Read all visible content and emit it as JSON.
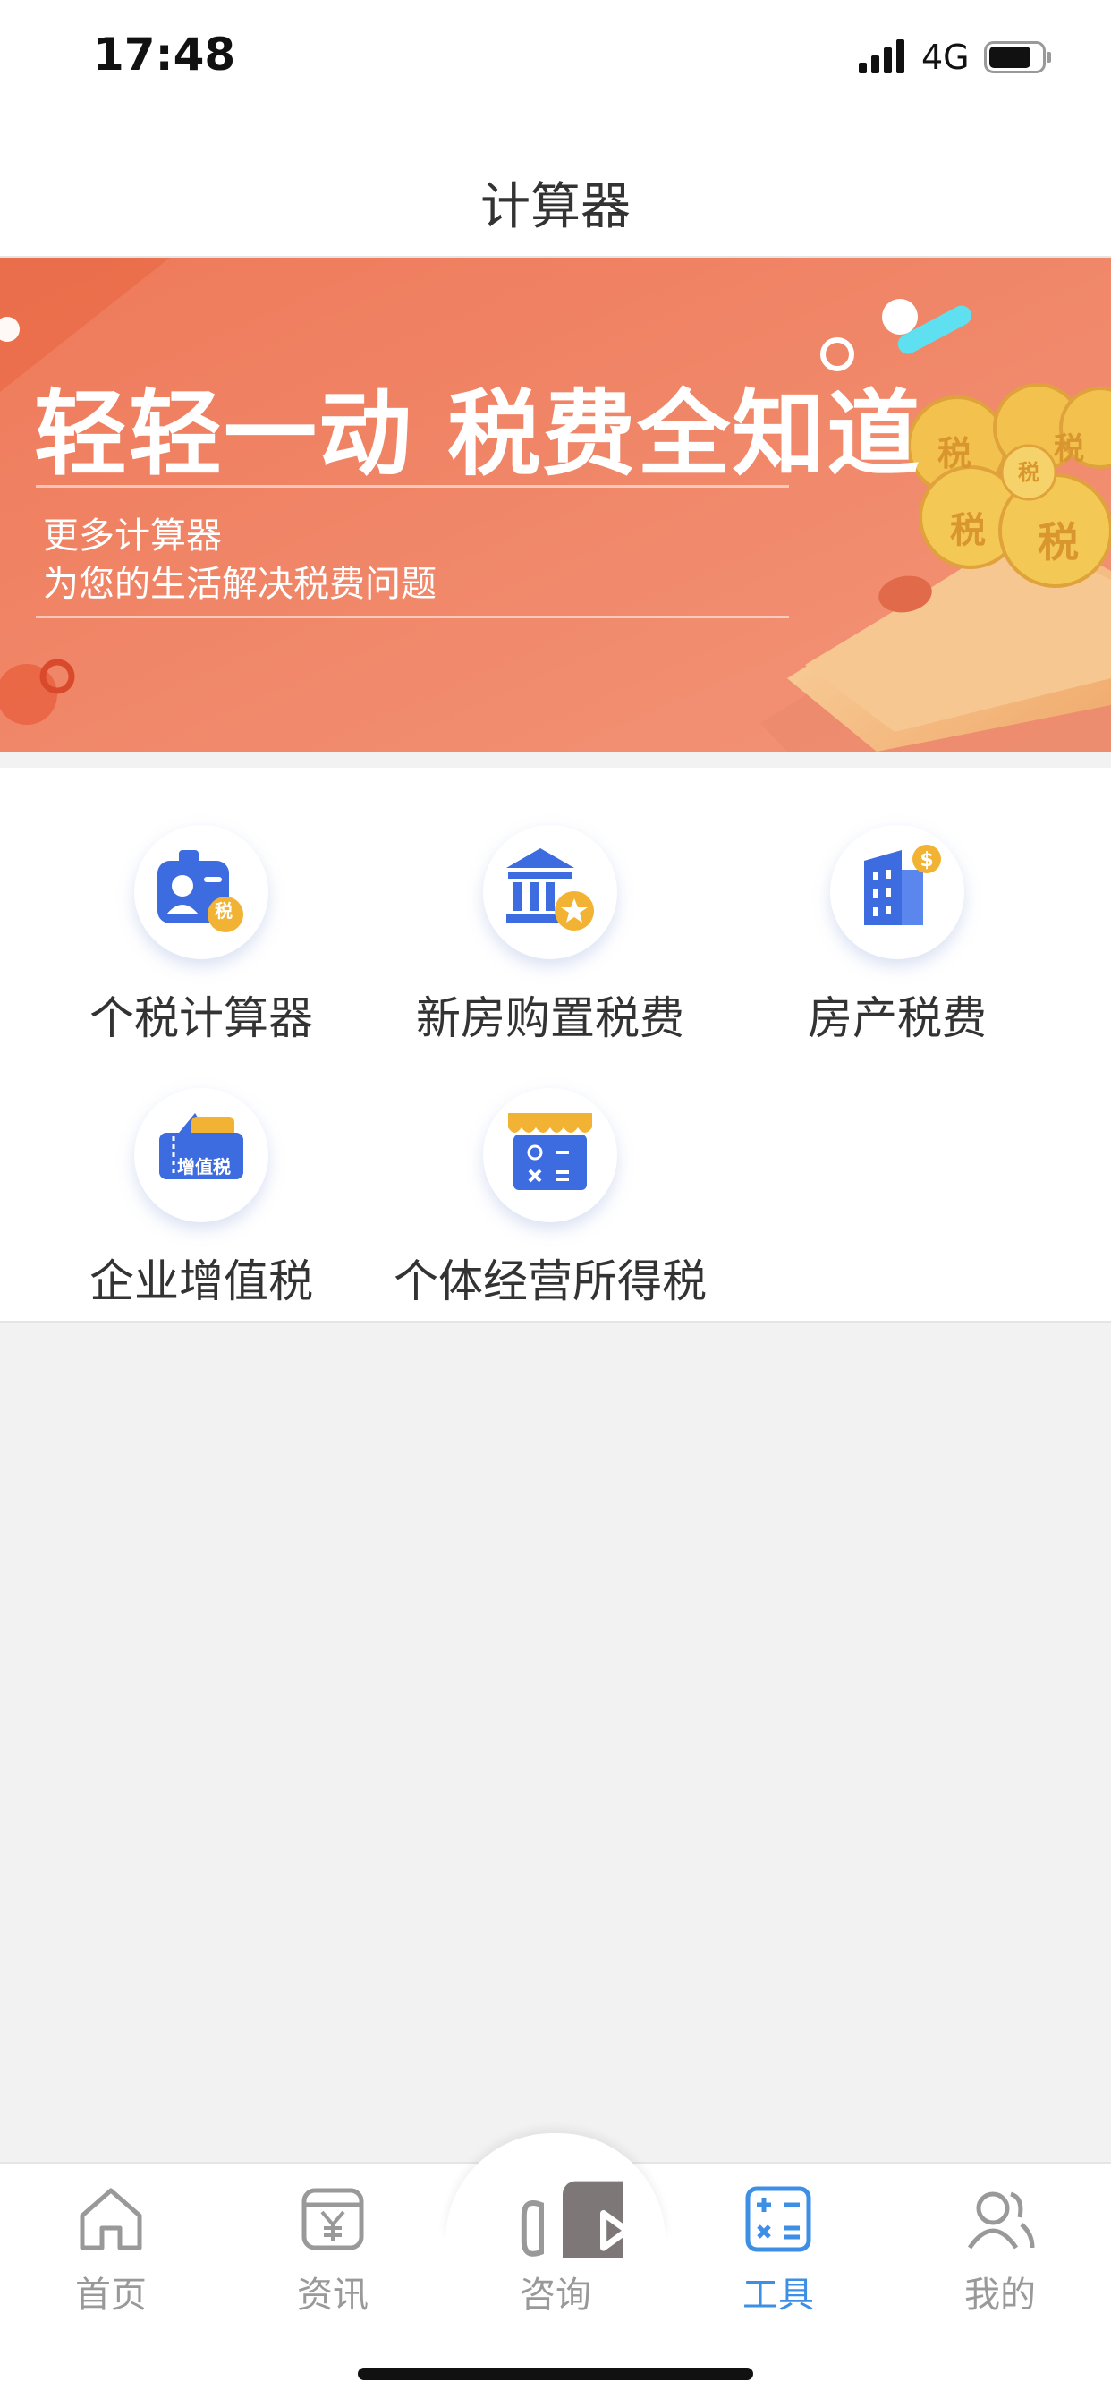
{
  "status_bar": {
    "time": "17:48",
    "network": "4G"
  },
  "nav": {
    "title": "计算器"
  },
  "banner": {
    "headline": "轻轻一动 税费全知道",
    "sub_line_1": "更多计算器",
    "sub_line_2": "为您的生活解决税费问题",
    "coin_text": "税"
  },
  "tools": [
    {
      "label": "个税计算器",
      "icon": "id-card-tax-icon"
    },
    {
      "label": "新房购置税费",
      "icon": "bank-building-star-icon"
    },
    {
      "label": "房产税费",
      "icon": "building-dollar-icon"
    },
    {
      "label": "企业增值税",
      "icon": "vat-ticket-icon",
      "icon_text": "增值税"
    },
    {
      "label": "个体经营所得税",
      "icon": "shop-calculator-icon"
    }
  ],
  "tabbar": {
    "items": [
      {
        "label": "首页",
        "icon": "home-icon",
        "active": false
      },
      {
        "label": "资讯",
        "icon": "news-yen-icon",
        "active": false
      },
      {
        "label": "咨询",
        "icon": "video-play-icon",
        "active": false
      },
      {
        "label": "工具",
        "icon": "calculator-icon",
        "active": true
      },
      {
        "label": "我的",
        "icon": "users-icon",
        "active": false
      }
    ]
  },
  "colors": {
    "accent": "#3d8fe6",
    "icon_blue": "#3d6be0",
    "icon_orange": "#f2b233",
    "banner_bg": "#ef8465",
    "inactive": "#999999"
  }
}
